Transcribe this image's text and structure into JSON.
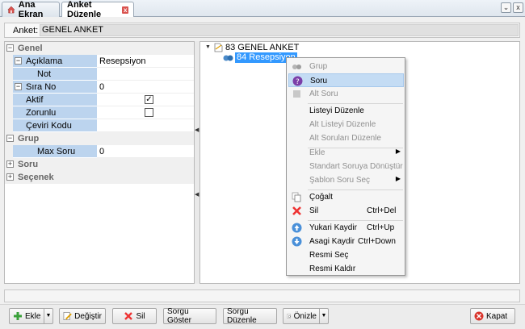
{
  "tabs": {
    "home_label": "Ana Ekran",
    "active_label": "Anket Düzenle",
    "close_glyph": "x"
  },
  "window": {
    "dropdown_glyph": "⌄",
    "close_glyph": "x"
  },
  "header": {
    "label": "Anket:",
    "value": "GENEL ANKET"
  },
  "property_grid": {
    "cat_genel": "Genel",
    "aciklama_label": "Açıklama",
    "aciklama_value": "Resepsiyon",
    "not_label": "Not",
    "sira_no_label": "Sıra No",
    "sira_no_value": "0",
    "aktif_label": "Aktif",
    "aktif_checked": "✓",
    "zorunlu_label": "Zorunlu",
    "ceviri_kodu_label": "Çeviri Kodu",
    "cat_grup": "Grup",
    "max_soru_label": "Max Soru",
    "max_soru_value": "0",
    "cat_soru": "Soru",
    "cat_secenek": "Seçenek"
  },
  "tree": {
    "root_label": "83 GENEL ANKET",
    "child_label": "84 Resepsiyon"
  },
  "context_menu": {
    "grup": "Grup",
    "soru": "Soru",
    "alt_soru": "Alt Soru",
    "listeyi_duzenle": "Listeyi Düzenle",
    "alt_listeyi_duzenle": "Alt Listeyi Düzenle",
    "alt_sorulari_duzenle": "Alt Soruları Düzenle",
    "ekle": "Ekle",
    "standart_soruya_donustur": "Standart Soruya Dönüştür",
    "sablon_soru_sec": "Şablon Soru Seç",
    "cogalt": "Çoğalt",
    "sil": "Sil",
    "sil_shortcut": "Ctrl+Del",
    "yukari_kaydir": "Yukari Kaydir",
    "yukari_shortcut": "Ctrl+Up",
    "asagi_kaydir": "Asagi Kaydir",
    "asagi_shortcut": "Ctrl+Down",
    "resmi_sec": "Resmi Seç",
    "resmi_kaldir": "Resmi Kaldır"
  },
  "buttons": {
    "ekle": "Ekle",
    "degistir": "Değiştir",
    "sil": "Sil",
    "sorgu_goster": "Sorgu Göster",
    "sorgu_duzenle": "Sorgu Düzenle",
    "onizle": "Önizle",
    "kapat": "Kapat"
  },
  "colors": {
    "selection": "#3399ff",
    "property_name_bg": "#bcd4ee",
    "menu_highlight": "#c4dcf4"
  }
}
